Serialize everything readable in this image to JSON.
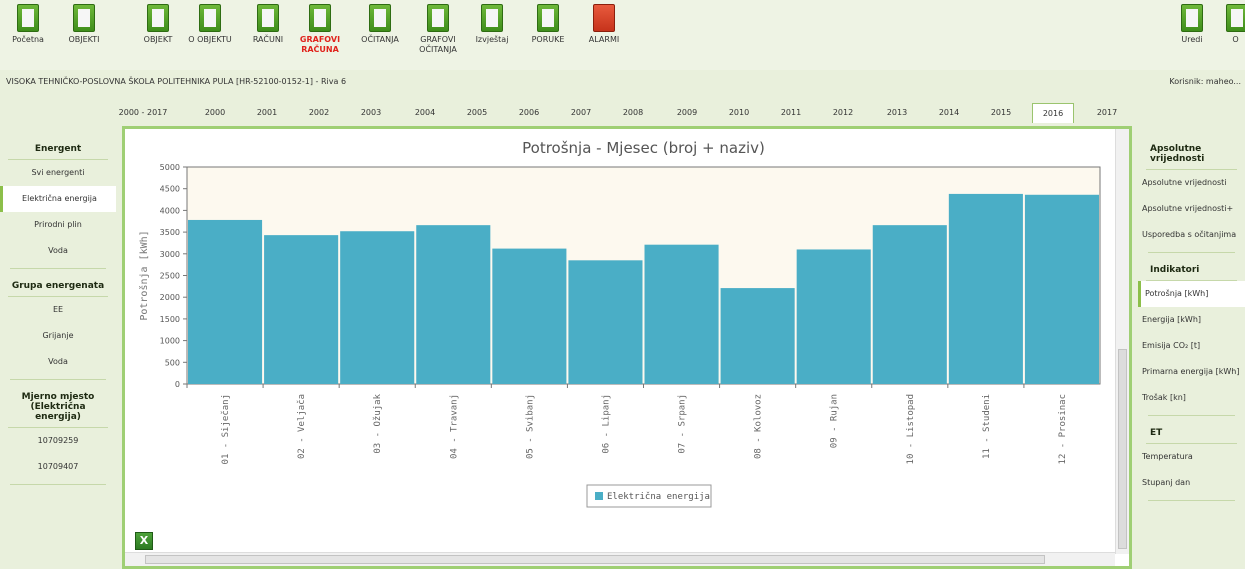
{
  "toolbar": {
    "items": [
      {
        "label": "Početna",
        "icon": "home-icon"
      },
      {
        "label": "OBJEKTI",
        "icon": "buildings-icon"
      },
      {
        "label": "OBJEKT",
        "icon": "building-icon"
      },
      {
        "label": "O OBJEKTU",
        "icon": "globe-icon"
      },
      {
        "label": "RAČUNI",
        "icon": "invoice-icon"
      },
      {
        "label": "GRAFOVI RAČUNA",
        "icon": "chart-icon",
        "active": true
      },
      {
        "label": "OČITANJA",
        "icon": "reading-icon"
      },
      {
        "label": "GRAFOVI OČITANJA",
        "icon": "chart-reading-icon"
      },
      {
        "label": "Izvještaj",
        "icon": "report-icon"
      },
      {
        "label": "PORUKE",
        "icon": "mail-icon"
      },
      {
        "label": "ALARMI",
        "icon": "alarm-icon"
      }
    ],
    "right_items": [
      {
        "label": "Uredi",
        "icon": "edit-icon"
      },
      {
        "label": "O",
        "icon": "other-icon"
      }
    ]
  },
  "breadcrumb": "VISOKA TEHNIČKO-POSLOVNA ŠKOLA POLITEHNIKA PULA [HR-52100-0152-1] - Riva 6",
  "user_label": "Korisnik: maheo...",
  "year_tabs": [
    "2000 - 2017",
    "2000",
    "2001",
    "2002",
    "2003",
    "2004",
    "2005",
    "2006",
    "2007",
    "2008",
    "2009",
    "2010",
    "2011",
    "2012",
    "2013",
    "2014",
    "2015",
    "2016",
    "2017"
  ],
  "active_year": "2016",
  "left_panel": {
    "energent_header": "Energent",
    "energent_items": [
      "Svi energenti",
      "Električna energija",
      "Prirodni plin",
      "Voda"
    ],
    "energent_selected": 1,
    "group_header": "Grupa energenata",
    "group_items": [
      "EE",
      "Grijanje",
      "Voda"
    ],
    "meter_header": "Mjerno mjesto (Električna energija)",
    "meter_items": [
      "10709259",
      "10709407"
    ]
  },
  "right_panel": {
    "abs_header": "Apsolutne vrijednosti",
    "abs_items": [
      "Apsolutne vrijednosti",
      "Apsolutne vrijednosti+",
      "Usporedba s očitanjima"
    ],
    "ind_header": "Indikatori",
    "ind_items": [
      "Potrošnja [kWh]",
      "Energija [kWh]",
      "Emisija CO₂ [t]",
      "Primarna energija [kWh]",
      "Trošak [kn]"
    ],
    "ind_selected": 0,
    "et_header": "ET",
    "et_items": [
      "Temperatura",
      "Stupanj dan"
    ]
  },
  "colors": {
    "bar": "#4aaec6",
    "plot_bg": "#fdf9ef",
    "accent": "#9fcf74"
  },
  "chart_data": {
    "type": "bar",
    "title": "Potrošnja - Mjesec (broj + naziv)",
    "ylabel": "Potrošnja [kWh]",
    "xlabel": "",
    "categories": [
      "01 - Siječanj",
      "02 - Veljača",
      "03 - Ožujak",
      "04 - Travanj",
      "05 - Svibanj",
      "06 - Lipanj",
      "07 - Srpanj",
      "08 - Kolovoz",
      "09 - Rujan",
      "10 - Listopad",
      "11 - Studeni",
      "12 - Prosinac"
    ],
    "series": [
      {
        "name": "Električna energija",
        "values": [
          3780,
          3430,
          3520,
          3660,
          3120,
          2850,
          3210,
          2210,
          3100,
          3660,
          4380,
          4360
        ]
      }
    ],
    "ylim": [
      0,
      5000
    ],
    "yticks": [
      0,
      500,
      1000,
      1500,
      2000,
      2500,
      3000,
      3500,
      4000,
      4500,
      5000
    ],
    "legend_position": "bottom-center",
    "grid": false
  }
}
